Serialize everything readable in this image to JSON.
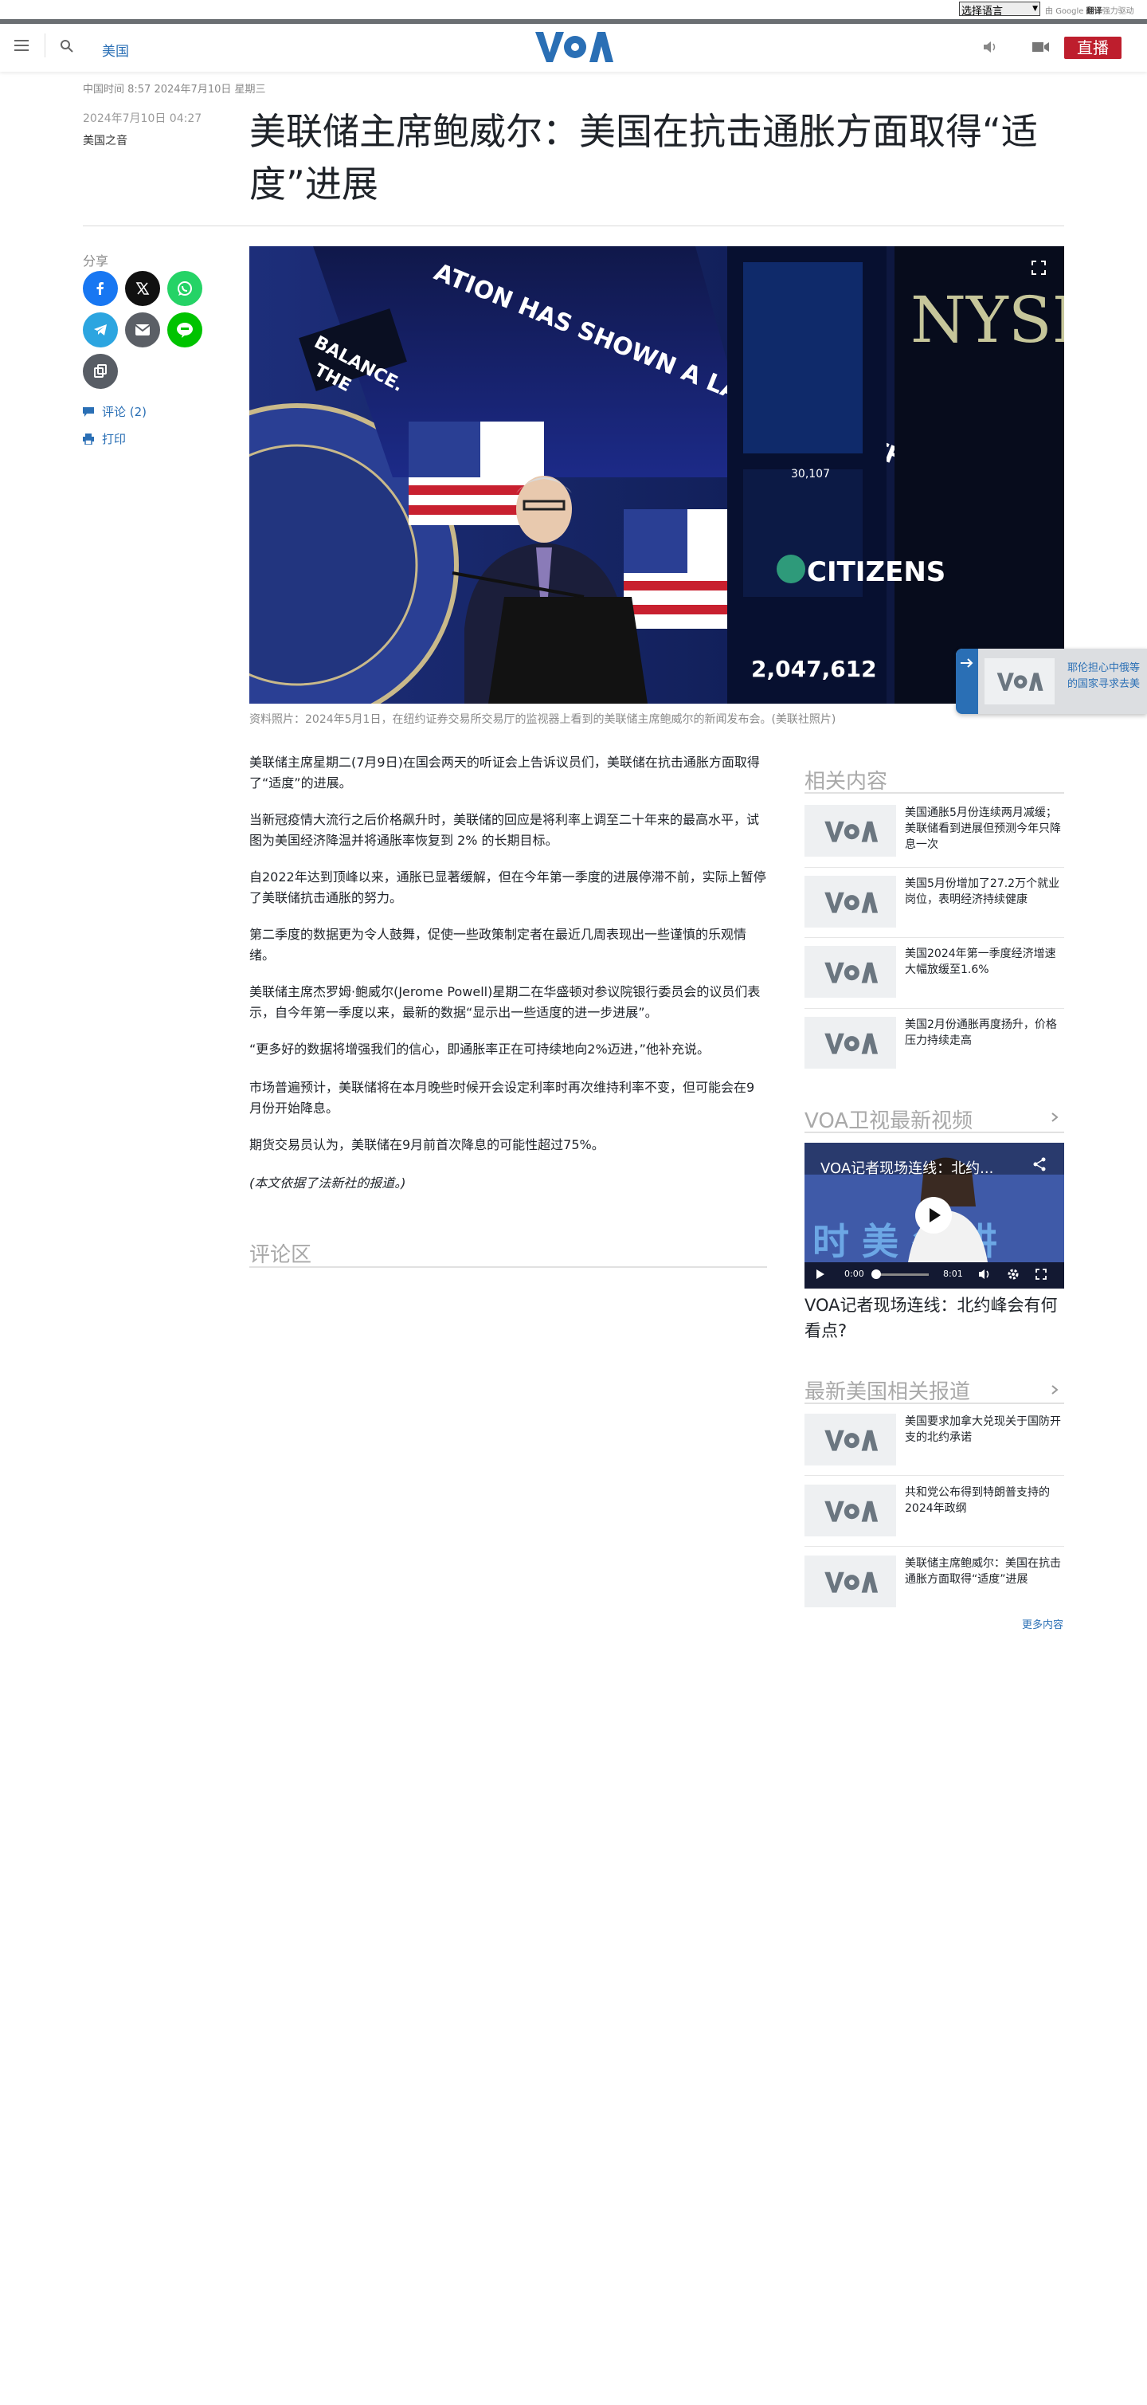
{
  "translate": {
    "select_value": "选择语言",
    "powered_by_prefix": "由",
    "powered_by_brand": "Google",
    "powered_by_translate": "翻译",
    "powered_by_suffix": "强力驱动"
  },
  "header": {
    "section_link": "美国",
    "live_label": "直播"
  },
  "article": {
    "china_time": "中国时间 8:57 2024年7月10日 星期三",
    "pub_date": "2024年7月10日 04:27",
    "author": "美国之音",
    "title": "美联储主席鲍威尔：美国在抗击通胀方面取得“适度”进展",
    "image_caption": "资料照片：2024年5月1日，在纽约证券交易所交易厅的监视器上看到的美联储主席鲍威尔的新闻发布会。(美联社照片)",
    "paragraphs": [
      "美联储主席星期二(7月9日)在国会两天的听证会上告诉议员们，美联储在抗击通胀方面取得了“适度”的进展。",
      "当新冠疫情大流行之后价格飙升时，美联储的回应是将利率上调至二十年来的最高水平，试图为美国经济降温并将通胀率恢复到 2% 的长期目标。",
      "自2022年达到顶峰以来，通胀已显著缓解，但在今年第一季度的进展停滞不前，实际上暂停了美联储抗击通胀的努力。",
      "第二季度的数据更为令人鼓舞，促使一些政策制定者在最近几周表现出一些谨慎的乐观情绪。",
      "美联储主席杰罗姆·鲍威尔(Jerome Powell)星期二在华盛顿对参议院银行委员会的议员们表示，自今年第一季度以来，最新的数据“显示出一些适度的进一步进展”。",
      "“更多好的数据将增强我们的信心，即通胀率正在可持续地向2%迈进，”他补充说。",
      "市场普遍预计，美联储将在本月晚些时候开会设定利率时再次维持利率不变，但可能会在9月份开始降息。",
      "期货交易员认为，美联储在9月前首次降息的可能性超过75%。",
      "(本文依据了法新社的报道。)"
    ]
  },
  "share": {
    "label": "分享",
    "comments_link": "评论 (2)",
    "print_link": "打印"
  },
  "image_overlay": {
    "screen_text": "ATION HAS SHOWN A LACK OF FURTHER PROGRESS",
    "balance": "BALANCE.",
    "the": "THE",
    "citizens": "CITIZENS",
    "nyse": "NYSE"
  },
  "comments": {
    "header": "评论区"
  },
  "related": {
    "header": "相关内容",
    "items": [
      {
        "title": "美国通胀5月份连续两月减缓；美联储看到进展但预测今年只降息一次"
      },
      {
        "title": "美国5月份增加了27.2万个就业岗位，表明经济持续健康"
      },
      {
        "title": "美国2024年第一季度经济增速大幅放缓至1.6%"
      },
      {
        "title": "美国2月份通胀再度扬升，价格压力持续走高"
      }
    ]
  },
  "videos": {
    "header": "VOA卫视最新视频",
    "player_title": "VOA记者现场连线：北约...",
    "time_current": "0:00",
    "time_total": "8:01",
    "progress": 0,
    "caption": "VOA记者现场连线：北约峰会有何看点?"
  },
  "latest_us": {
    "header": "最新美国相关报道",
    "items": [
      {
        "title": "美国要求加拿大兑现关于国防开支的北约承诺"
      },
      {
        "title": "共和党公布得到特朗普支持的2024年政纲"
      },
      {
        "title": "美联储主席鲍威尔：美国在抗击通胀方面取得“适度”进展"
      }
    ],
    "more_link": "更多内容"
  },
  "floating_card": {
    "line1": "耶伦担心中俄等",
    "line2": "的国家寻求去美"
  },
  "colors": {
    "accent_blue": "#2a6fb5",
    "live_red": "#be1e2d",
    "facebook": "#1877f2",
    "x": "#111111",
    "whatsapp": "#25d366",
    "telegram": "#2ca5e0",
    "email": "#5b5f66",
    "line": "#00c300",
    "copy": "#585d65"
  },
  "icons": [
    "menu-icon",
    "search-icon",
    "voa-logo",
    "speaker-icon",
    "video-camera-icon",
    "facebook-icon",
    "x-icon",
    "whatsapp-icon",
    "telegram-icon",
    "email-icon",
    "line-icon",
    "copy-icon",
    "comment-icon",
    "print-icon",
    "fullscreen-icon",
    "chevron-right-icon",
    "play-icon",
    "volume-icon",
    "settings-icon",
    "share-icon"
  ]
}
